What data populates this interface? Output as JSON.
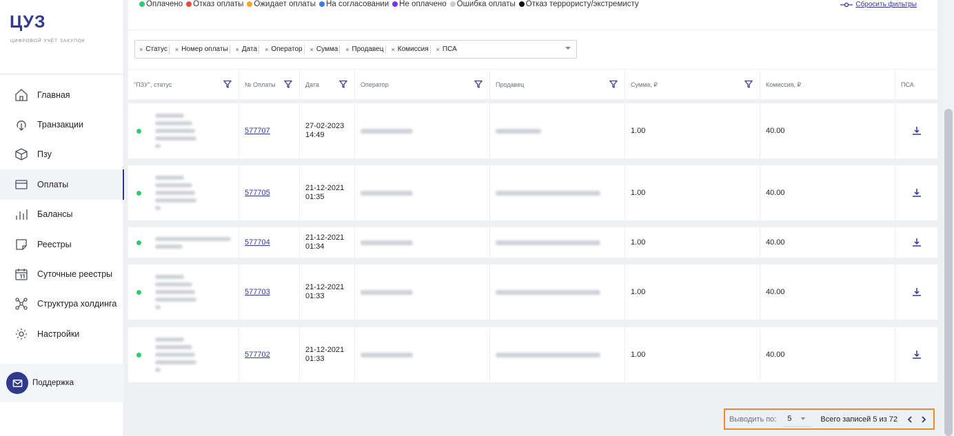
{
  "logo": {
    "title": "ЦУЗ",
    "subtitle": "цифровой учёт закупок"
  },
  "sidebar": {
    "items": [
      {
        "label": "Главная",
        "icon": "home-icon"
      },
      {
        "label": "Транзакции",
        "icon": "transactions-icon"
      },
      {
        "label": "Пзу",
        "icon": "box-icon"
      },
      {
        "label": "Оплаты",
        "icon": "card-icon",
        "active": true
      },
      {
        "label": "Балансы",
        "icon": "bars-icon"
      },
      {
        "label": "Реестры",
        "icon": "document-icon"
      },
      {
        "label": "Суточные реестры",
        "icon": "calendar-icon"
      },
      {
        "label": "Структура холдинга",
        "icon": "structure-icon"
      },
      {
        "label": "Настройки",
        "icon": "gear-icon"
      }
    ],
    "support_label": "Поддержка"
  },
  "legend": [
    {
      "label": "Оплачено",
      "color": "#2ecc71"
    },
    {
      "label": "Отказ оплаты",
      "color": "#e74c3c"
    },
    {
      "label": "Ожидает оплаты",
      "color": "#f5a623"
    },
    {
      "label": "На согласовании",
      "color": "#3b7ddd"
    },
    {
      "label": "Не оплачено",
      "color": "#7b2ff7"
    },
    {
      "label": "Ошибка оплаты",
      "color": "#c8cbd1"
    },
    {
      "label": "Отказ террористу/экстремисту",
      "color": "#111111"
    }
  ],
  "reset_filters_label": "Сбросить фильтры",
  "filter_chips": [
    "Статус",
    "Номер оплаты",
    "Дата",
    "Оператор",
    "Сумма",
    "Продавец",
    "Комиссия",
    "ПСА"
  ],
  "columns": [
    "\"ПЗУ\", статус",
    "№ Оплаты",
    "Дата",
    "Оператор",
    "Продавец",
    "Сумма, ₽",
    "Комиссия, ₽",
    "ПСА"
  ],
  "rows": [
    {
      "pay_no": "577707",
      "date": "27-02-2023\n14:49",
      "sum": "1.00",
      "commission": "40.00"
    },
    {
      "pay_no": "577705",
      "date": "21-12-2021\n01:35",
      "sum": "1.00",
      "commission": "40.00"
    },
    {
      "pay_no": "577704",
      "date": "21-12-2021\n01:34",
      "sum": "1.00",
      "commission": "40.00"
    },
    {
      "pay_no": "577703",
      "date": "21-12-2021\n01:33",
      "sum": "1.00",
      "commission": "40.00"
    },
    {
      "pay_no": "577702",
      "date": "21-12-2021\n01:33",
      "sum": "1.00",
      "commission": "40.00"
    }
  ],
  "pagination": {
    "per_page_label": "Выводить по:",
    "per_page_value": "5",
    "total_label": "Всего записей 5 из 72"
  },
  "colors": {
    "accent": "#2f3a8f",
    "paid": "#2ecc71",
    "highlight": "#ef8a2b"
  }
}
